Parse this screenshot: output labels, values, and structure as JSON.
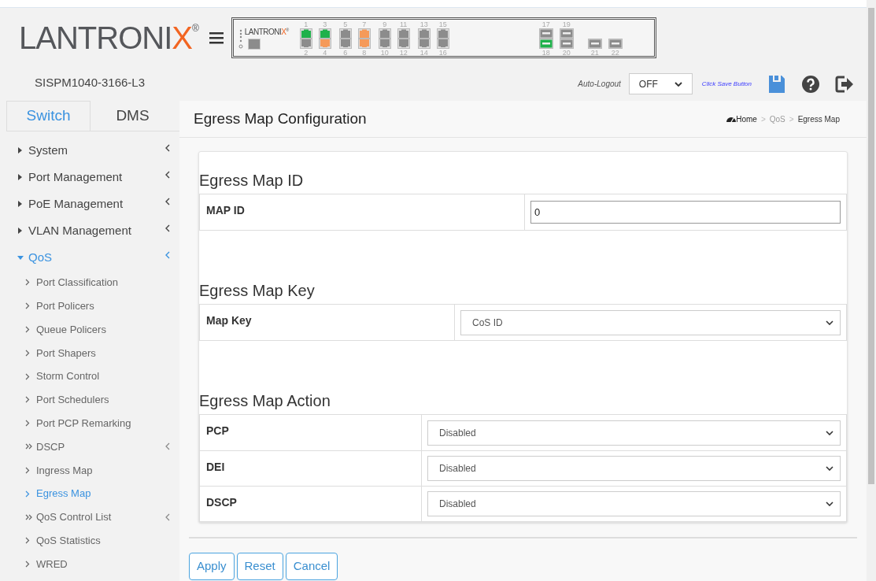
{
  "header": {
    "logo": {
      "text": "LANTRONI",
      "accent": "X",
      "mark": "®"
    },
    "panel_logo": {
      "text": "LANTRONI",
      "accent": "X",
      "mark": "®"
    },
    "ports": [
      {
        "kind": "rj45",
        "top": {
          "label": "1",
          "color": "#1fb14b"
        },
        "bottom": {
          "label": "2",
          "color": "#8c8c8c"
        }
      },
      {
        "kind": "rj45",
        "top": {
          "label": "3",
          "color": "#1fb14b"
        },
        "bottom": {
          "label": "4",
          "color": "#f59a5a"
        }
      },
      {
        "kind": "rj45",
        "top": {
          "label": "5",
          "color": "#8c8c8c"
        },
        "bottom": {
          "label": "6",
          "color": "#8c8c8c"
        }
      },
      {
        "kind": "rj45",
        "top": {
          "label": "7",
          "color": "#f59a5a"
        },
        "bottom": {
          "label": "8",
          "color": "#f59a5a"
        }
      },
      {
        "kind": "rj45",
        "top": {
          "label": "9",
          "color": "#8c8c8c"
        },
        "bottom": {
          "label": "10",
          "color": "#8c8c8c"
        }
      },
      {
        "kind": "rj45",
        "top": {
          "label": "11",
          "color": "#8c8c8c"
        },
        "bottom": {
          "label": "12",
          "color": "#8c8c8c"
        }
      },
      {
        "kind": "rj45",
        "top": {
          "label": "13",
          "color": "#8c8c8c"
        },
        "bottom": {
          "label": "14",
          "color": "#8c8c8c"
        }
      },
      {
        "kind": "rj45",
        "top": {
          "label": "15",
          "color": "#8c8c8c"
        },
        "bottom": {
          "label": "16",
          "color": "#8c8c8c"
        }
      },
      {
        "kind": "sfp",
        "top": {
          "label": "17",
          "color": "#8c8c8c"
        },
        "bottom": {
          "label": "18",
          "color": "#1fb14b"
        }
      },
      {
        "kind": "sfp",
        "top": {
          "label": "19",
          "color": "#8c8c8c"
        },
        "bottom": {
          "label": "20",
          "color": "#8c8c8c"
        }
      },
      {
        "kind": "sfp_single",
        "bottom": {
          "label": "21",
          "color": "#8c8c8c"
        }
      },
      {
        "kind": "sfp_single",
        "bottom": {
          "label": "22",
          "color": "#8c8c8c"
        }
      }
    ]
  },
  "sidebar": {
    "device_name": "SISPM1040-3166-L3",
    "tabs": [
      {
        "label": "Switch",
        "selected": true
      },
      {
        "label": "DMS",
        "selected": false
      }
    ],
    "items": [
      {
        "label": "System",
        "expanded": false
      },
      {
        "label": "Port Management",
        "expanded": false
      },
      {
        "label": "PoE Management",
        "expanded": false
      },
      {
        "label": "VLAN Management",
        "expanded": false
      },
      {
        "label": "QoS",
        "expanded": true,
        "children": [
          {
            "label": "Port Classification",
            "kind": "link",
            "selected": false
          },
          {
            "label": "Port Policers",
            "kind": "link",
            "selected": false
          },
          {
            "label": "Queue Policers",
            "kind": "link",
            "selected": false
          },
          {
            "label": "Port Shapers",
            "kind": "link",
            "selected": false
          },
          {
            "label": "Storm Control",
            "kind": "link",
            "selected": false
          },
          {
            "label": "Port Schedulers",
            "kind": "link",
            "selected": false
          },
          {
            "label": "Port PCP Remarking",
            "kind": "link",
            "selected": false
          },
          {
            "label": "DSCP",
            "kind": "group",
            "selected": false
          },
          {
            "label": "Ingress Map",
            "kind": "link",
            "selected": false
          },
          {
            "label": "Egress Map",
            "kind": "link",
            "selected": true
          },
          {
            "label": "QoS Control List",
            "kind": "group",
            "selected": false
          },
          {
            "label": "QoS Statistics",
            "kind": "link",
            "selected": false
          },
          {
            "label": "WRED",
            "kind": "link",
            "selected": false
          }
        ]
      }
    ]
  },
  "toolbar": {
    "auto_logout_label": "Auto-Logout",
    "auto_logout_value": "OFF",
    "save_hint": "Click Save Button"
  },
  "page": {
    "title": "Egress Map Configuration",
    "breadcrumb": [
      "Home",
      "QoS",
      "Egress Map"
    ],
    "breadcrumb_separators": [
      ">",
      ">"
    ],
    "sections": [
      {
        "title": "Egress Map ID",
        "rows": [
          {
            "label": "MAP ID",
            "kind": "input",
            "value": "0"
          }
        ]
      },
      {
        "title": "Egress Map Key",
        "rows": [
          {
            "label": "Map Key",
            "kind": "select",
            "value": "CoS ID"
          }
        ]
      },
      {
        "title": "Egress Map Action",
        "rows": [
          {
            "label": "PCP",
            "kind": "select",
            "value": "Disabled"
          },
          {
            "label": "DEI",
            "kind": "select",
            "value": "Disabled"
          },
          {
            "label": "DSCP",
            "kind": "select",
            "value": "Disabled"
          }
        ]
      }
    ],
    "buttons": [
      "Apply",
      "Reset",
      "Cancel"
    ]
  }
}
